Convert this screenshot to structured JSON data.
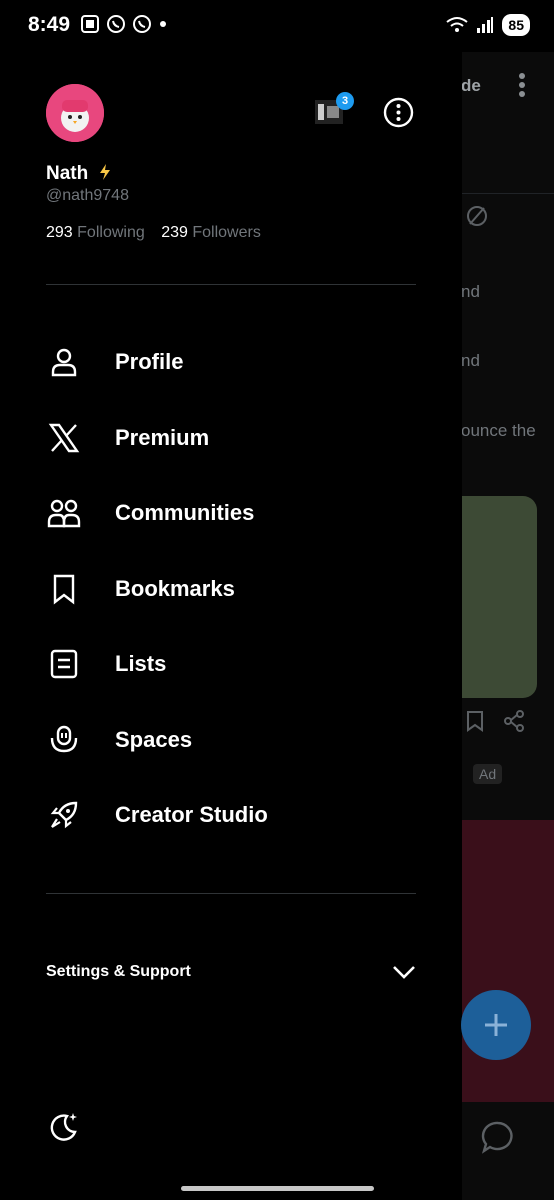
{
  "status_bar": {
    "time": "8:49",
    "battery": "85"
  },
  "profile": {
    "name": "Nath",
    "handle": "@nath9748",
    "following_count": "293",
    "following_label": "Following",
    "followers_count": "239",
    "followers_label": "Followers",
    "notification_badge": "3"
  },
  "menu": [
    {
      "label": "Profile",
      "icon": "person-icon"
    },
    {
      "label": "Premium",
      "icon": "x-logo-icon"
    },
    {
      "label": "Communities",
      "icon": "communities-icon"
    },
    {
      "label": "Bookmarks",
      "icon": "bookmark-icon"
    },
    {
      "label": "Lists",
      "icon": "list-icon"
    },
    {
      "label": "Spaces",
      "icon": "spaces-icon"
    },
    {
      "label": "Creator Studio",
      "icon": "rocket-icon"
    }
  ],
  "settings": {
    "label": "Settings & Support"
  },
  "background_feed": {
    "header_fragment": "de",
    "text_fragments": [
      "nd",
      "nd",
      "ounce the"
    ],
    "ad_label": "Ad"
  }
}
